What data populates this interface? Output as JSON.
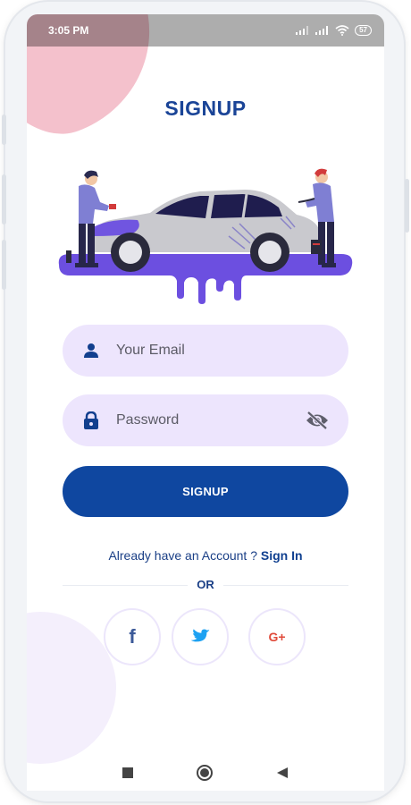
{
  "status_bar": {
    "time": "3:05 PM",
    "icons": [
      "signal-icon",
      "signal-icon",
      "wifi-icon"
    ],
    "battery": "57"
  },
  "page": {
    "title": "SIGNUP"
  },
  "hero": {
    "illustration": "car-painting-illustration",
    "colors": {
      "paint": "#6c4fe0",
      "car": "#c9c9ce",
      "worker": "#7f7fd3"
    }
  },
  "form": {
    "email": {
      "placeholder": "Your Email",
      "value": "",
      "icon": "person-icon"
    },
    "password": {
      "placeholder": "Password",
      "value": "",
      "icon": "lock-icon",
      "toggle_icon": "eye-off-icon"
    },
    "submit_label": "SIGNUP"
  },
  "account": {
    "prompt": "Already have an Account ? ",
    "link_label": "Sign In"
  },
  "divider": {
    "label": "OR"
  },
  "social": {
    "facebook": "f",
    "twitter": "twitter-icon",
    "google": "G+"
  },
  "nav": [
    "recents-icon",
    "home-icon",
    "back-icon"
  ],
  "colors": {
    "primary": "#0f47a0",
    "field_bg": "#ede5fd",
    "title": "#1a4497",
    "blob_pink": "#f4c1cc"
  }
}
